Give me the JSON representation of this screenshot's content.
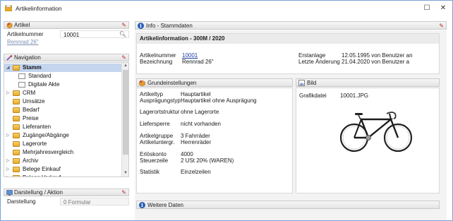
{
  "window": {
    "title": "Artikelinformation",
    "buttons": {
      "maximize": "☐",
      "close": "✕"
    }
  },
  "artikel_panel": {
    "header": "Artikel",
    "field_label": "Artikelnummer",
    "field_value": "10001",
    "sub_link": "Rennrad 26\""
  },
  "navigation": {
    "header": "Navigation",
    "items": [
      {
        "label": "Stamm",
        "type": "folder",
        "level": 0,
        "expander": "◢",
        "selected": true
      },
      {
        "label": "Standard",
        "type": "doc",
        "level": 1,
        "expander": "",
        "selected": false
      },
      {
        "label": "Digitale Akte",
        "type": "doc",
        "level": 1,
        "expander": "",
        "selected": false
      },
      {
        "label": "CRM",
        "type": "folder",
        "level": 0,
        "expander": "▷",
        "selected": false
      },
      {
        "label": "Umsätze",
        "type": "folder",
        "level": 0,
        "expander": "",
        "selected": false
      },
      {
        "label": "Bedarf",
        "type": "folder",
        "level": 0,
        "expander": "",
        "selected": false
      },
      {
        "label": "Preise",
        "type": "folder",
        "level": 0,
        "expander": "",
        "selected": false
      },
      {
        "label": "Lieferanten",
        "type": "folder",
        "level": 0,
        "expander": "",
        "selected": false
      },
      {
        "label": "Zugänge/Abgänge",
        "type": "folder",
        "level": 0,
        "expander": "▷",
        "selected": false
      },
      {
        "label": "Lagerorte",
        "type": "folder",
        "level": 0,
        "expander": "",
        "selected": false
      },
      {
        "label": "Mehrjahresvergleich",
        "type": "folder",
        "level": 0,
        "expander": "",
        "selected": false
      },
      {
        "label": "Archiv",
        "type": "folder",
        "level": 0,
        "expander": "▷",
        "selected": false
      },
      {
        "label": "Belege Einkauf",
        "type": "folder",
        "level": 0,
        "expander": "▷",
        "selected": false
      },
      {
        "label": "Belege Verkauf",
        "type": "folder",
        "level": 0,
        "expander": "▷",
        "selected": false
      }
    ]
  },
  "darstellung_panel": {
    "header": "Darstellung / Aktion",
    "field_label": "Darstellung",
    "field_value": "0 Formular"
  },
  "info_header": "Info - Stammdaten",
  "artikelinfo": {
    "title": "Artikelinformation - 300M / 2020",
    "labels": [
      "Artikelnummer",
      "Bezeichnung"
    ],
    "values": [
      "10001",
      "Rennrad 26\""
    ],
    "right_labels": [
      "Erstanlage",
      "Letzte Änderung"
    ],
    "right_values": [
      "12.05.1995  von Benutzer an",
      "21.04.2020  von Benutzer a"
    ]
  },
  "grundeinstellungen": {
    "header": "Grundeinstellungen",
    "rows": [
      {
        "label": "Artikeltyp",
        "value": "Hauptartikel"
      },
      {
        "label": "Ausprägungstyp",
        "value": "Hauptartikel ohne Ausprägung"
      },
      {
        "label": "Lagerortstruktur",
        "value": "ohne Lagerorte"
      },
      {
        "label": "Liefersperre",
        "value": "nicht vorhanden"
      },
      {
        "label": "Artikelgruppe",
        "value": "3  Fahrräder"
      },
      {
        "label": "Artikeluntergr.",
        "value": "Herrenräder"
      },
      {
        "label": "Erlöskonto",
        "value": "4000"
      },
      {
        "label": "Steuerzeile",
        "value": "2  USt 20% (WAREN)"
      },
      {
        "label": "Statistik",
        "value": "Einzelzeilen"
      }
    ]
  },
  "bild": {
    "header": "Bild",
    "label": "Grafikdatei",
    "value": "10001.JPG"
  },
  "weitere_daten": {
    "header": "Weitere Daten"
  },
  "colors": {
    "accent": "#1f3fa5",
    "selection": "#c4d5ee",
    "pin": "#c0282d",
    "folder": "#e7a92c"
  }
}
